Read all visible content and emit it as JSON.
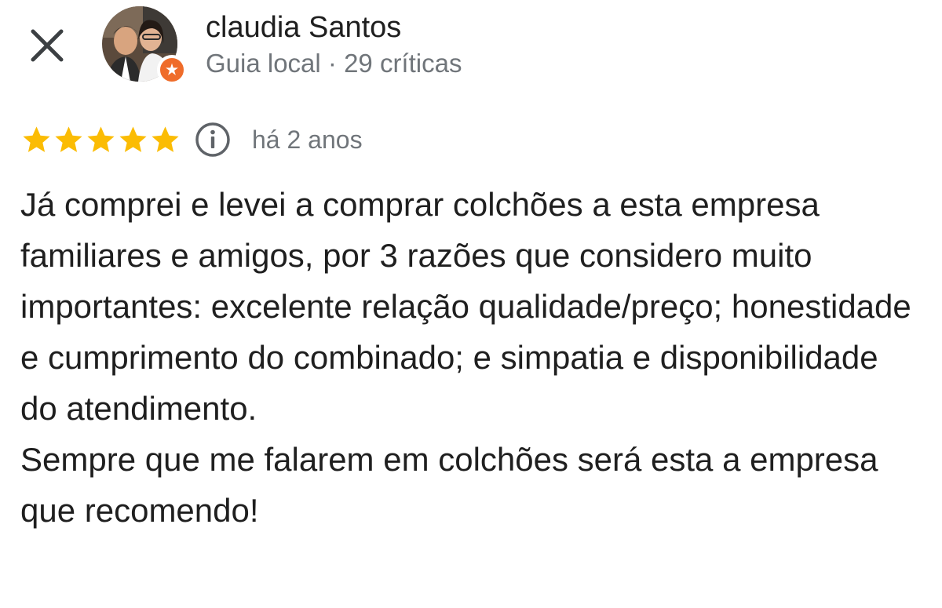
{
  "review": {
    "reviewer": {
      "name": "claudia Santos",
      "meta": "Guia local · 29 críticas",
      "badge_color": "#ef6c2a"
    },
    "rating": {
      "stars": 5,
      "max": 5,
      "star_color": "#fbbc04"
    },
    "date": "há 2 anos",
    "paragraphs": [
      "Já comprei e levei a comprar colchões a esta empresa familiares e amigos, por 3 razões que considero muito importantes: excelente relação qualidade/preço; honestidade e cumprimento do combinado; e simpatia e disponibilidade do atendimento.",
      "Sempre que me falarem em colchões será esta a empresa que recomendo!"
    ]
  },
  "icons": {
    "close": "close-icon",
    "info": "info-icon",
    "badge": "local-guide-star-icon",
    "star": "star-icon"
  },
  "colors": {
    "text_primary": "#1f1f1f",
    "text_secondary": "#70757a",
    "icon": "#3c4043"
  }
}
